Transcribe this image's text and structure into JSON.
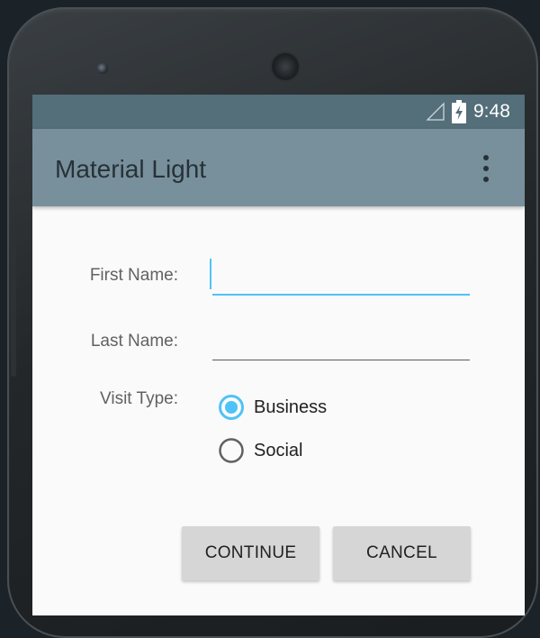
{
  "status_bar": {
    "time": "9:48",
    "icons": [
      "signal-icon",
      "battery-charging-icon"
    ]
  },
  "app_bar": {
    "title": "Material Light",
    "overflow_icon": "more-vert-icon"
  },
  "form": {
    "first_name": {
      "label": "First Name:",
      "value": "",
      "focused": true
    },
    "last_name": {
      "label": "Last Name:",
      "value": ""
    },
    "visit_type": {
      "label": "Visit Type:",
      "options": [
        {
          "label": "Business",
          "selected": true
        },
        {
          "label": "Social",
          "selected": false
        }
      ]
    }
  },
  "actions": {
    "continue_label": "CONTINUE",
    "cancel_label": "CANCEL"
  },
  "colors": {
    "status_bar": "#546e7a",
    "app_bar": "#78909c",
    "accent": "#4fc3f7",
    "background": "#fafafa",
    "button": "#d6d6d6"
  }
}
